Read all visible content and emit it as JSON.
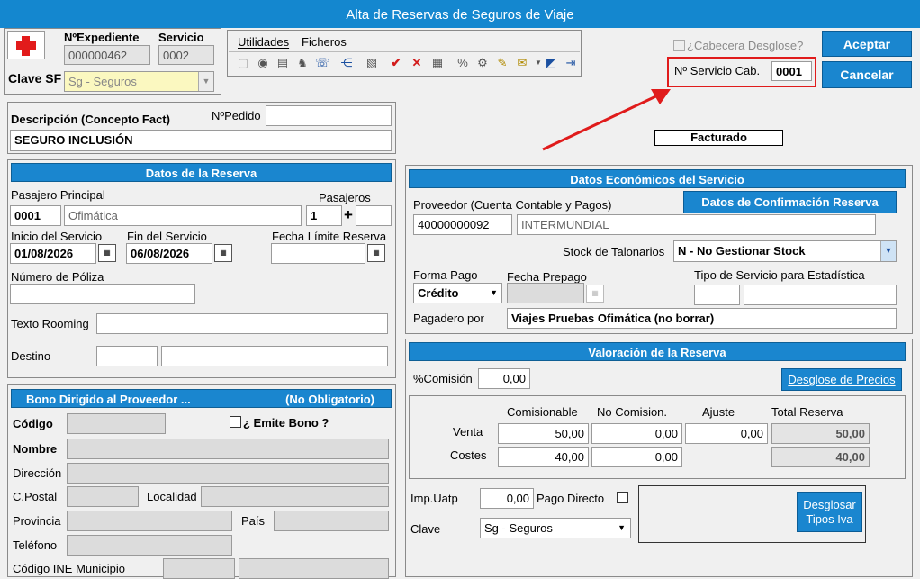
{
  "window": {
    "title": "Alta de Reservas de Seguros de Viaje"
  },
  "header": {
    "expediente_label": "NºExpediente",
    "expediente_value": "000000462",
    "servicio_label": "Servicio",
    "servicio_value": "0002",
    "clave_sf_label": "Clave SF",
    "clave_sf_value": "Sg - Seguros",
    "menu": [
      "Utilidades",
      "Ficheros"
    ],
    "cabecera_desglose_label": "¿Cabecera Desglose?",
    "servicio_cab_label": "Nº Servicio Cab.",
    "servicio_cab_value": "0001",
    "accept_label": "Aceptar",
    "cancel_label": "Cancelar"
  },
  "descripcion": {
    "label": "Descripción (Concepto Fact)",
    "pedido_label": "NºPedido",
    "pedido_value": "",
    "value": "SEGURO INCLUSIÓN"
  },
  "facturado_label": "Facturado",
  "reserva": {
    "header": "Datos de la Reserva",
    "pasajero_label": "Pasajero Principal",
    "pasajero_code": "0001",
    "pasajero_name": "Ofimática",
    "pasajeros_label": "Pasajeros",
    "pasajeros_value": "1",
    "plus": "+",
    "inicio_label": "Inicio del Servicio",
    "inicio_value": "01/08/2026",
    "fin_label": "Fin del Servicio",
    "fin_value": "06/08/2026",
    "limite_label": "Fecha Límite Reserva",
    "poliza_label": "Número de Póliza",
    "rooming_label": "Texto Rooming",
    "destino_label": "Destino"
  },
  "bono": {
    "header": "Bono Dirigido al Proveedor ...",
    "header_right": "(No Obligatorio)",
    "codigo_label": "Código",
    "emite_label": "¿ Emite Bono ?",
    "nombre_label": "Nombre",
    "direccion_label": "Dirección",
    "cpostal_label": "C.Postal",
    "localidad_label": "Localidad",
    "provincia_label": "Provincia",
    "pais_label": "País",
    "telefono_label": "Teléfono",
    "ine_label": "Código INE Municipio"
  },
  "economicos": {
    "header": "Datos Económicos del Servicio",
    "proveedor_label": "Proveedor (Cuenta Contable y Pagos)",
    "confirmacion_button": "Datos de Confirmación Reserva",
    "proveedor_code": "40000000092",
    "proveedor_name": "INTERMUNDIAL",
    "stock_label": "Stock de Talonarios",
    "stock_value": "N - No Gestionar Stock",
    "forma_pago_label": "Forma Pago",
    "forma_pago_value": "Crédito",
    "fecha_prepago_label": "Fecha Prepago",
    "tipo_servicio_label": "Tipo de Servicio para Estadística",
    "pagadero_label": "Pagadero por",
    "pagadero_value": "Viajes Pruebas Ofimática (no borrar)"
  },
  "valoracion": {
    "header": "Valoración de la Reserva",
    "comision_label": "%Comisión",
    "comision_value": "0,00",
    "desglose_button": "Desglose de Precios",
    "columns": [
      "Comisionable",
      "No Comision.",
      "Ajuste",
      "Total Reserva"
    ],
    "venta_label": "Venta",
    "venta": [
      "50,00",
      "0,00",
      "0,00",
      "50,00"
    ],
    "costes_label": "Costes",
    "costes": [
      "40,00",
      "0,00",
      "40,00"
    ],
    "uatp_label": "Imp.Uatp",
    "uatp_value": "0,00",
    "pago_directo_label": "Pago Directo",
    "clave_label": "Clave",
    "clave_value": "Sg - Seguros",
    "desglosar_line1": "Desglosar",
    "desglosar_line2": "Tipos Iva"
  },
  "colors": {
    "accent": "#1a86cf",
    "highlight": "#e01b1b"
  }
}
